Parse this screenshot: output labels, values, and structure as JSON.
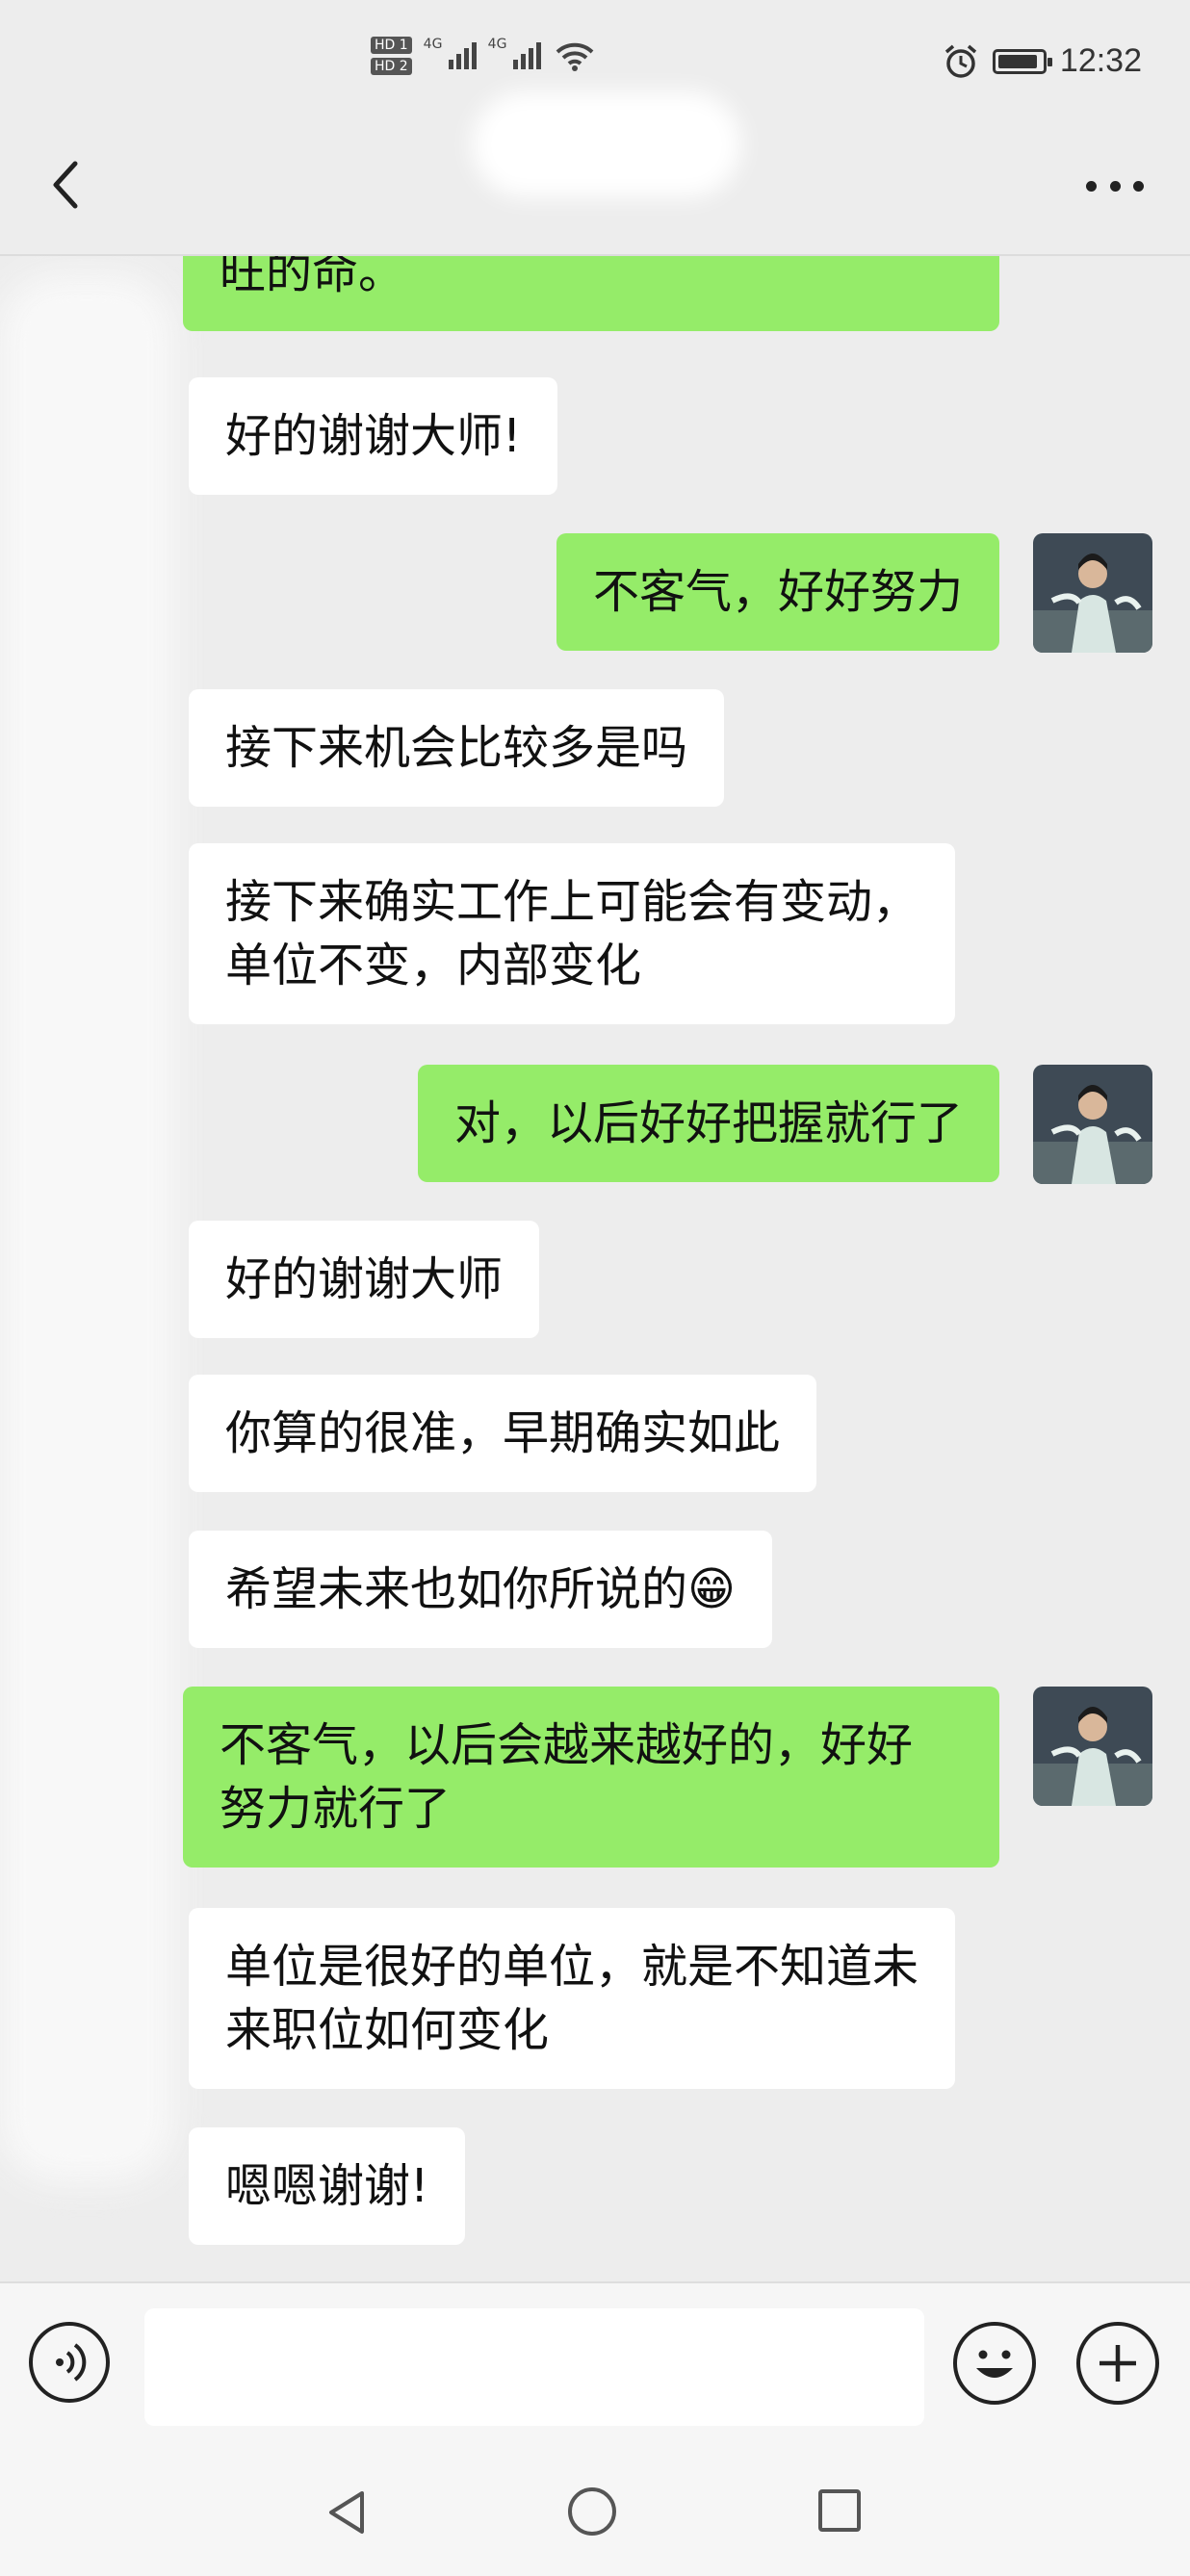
{
  "status_bar": {
    "sim_tags": [
      "HD 1",
      "HD 2"
    ],
    "network_tags": [
      "4G",
      "4G"
    ],
    "time": "12:32",
    "battery_level": 0.9
  },
  "header": {
    "back_icon": "chevron-left-icon",
    "more_icon": "more-dots-icon"
  },
  "colors": {
    "background": "#ededed",
    "incoming_bubble": "#ffffff",
    "outgoing_bubble": "#95ec69"
  },
  "messages": [
    {
      "side": "out",
      "text": "旺的命。"
    },
    {
      "side": "in",
      "text": "好的谢谢大师!"
    },
    {
      "side": "out",
      "text": "不客气，好好努力"
    },
    {
      "side": "in",
      "text": "接下来机会比较多是吗"
    },
    {
      "side": "in",
      "text": "接下来确实工作上可能会有变动，\n单位不变，内部变化"
    },
    {
      "side": "out",
      "text": "对，以后好好把握就行了"
    },
    {
      "side": "in",
      "text": "好的谢谢大师"
    },
    {
      "side": "in",
      "text": "你算的很准，早期确实如此"
    },
    {
      "side": "in",
      "text": "希望未来也如你所说的😁"
    },
    {
      "side": "out",
      "text": "不客气，以后会越来越好的，好好\n努力就行了"
    },
    {
      "side": "in",
      "text": "单位是很好的单位，就是不知道未\n来职位如何变化"
    },
    {
      "side": "in",
      "text": "嗯嗯谢谢!"
    }
  ],
  "input_bar": {
    "voice_icon": "voice-icon",
    "emoji_icon": "emoji-icon",
    "plus_icon": "plus-icon"
  },
  "nav_bar": {
    "back_icon": "triangle-back-icon",
    "home_icon": "circle-home-icon",
    "recent_icon": "square-recent-icon"
  }
}
